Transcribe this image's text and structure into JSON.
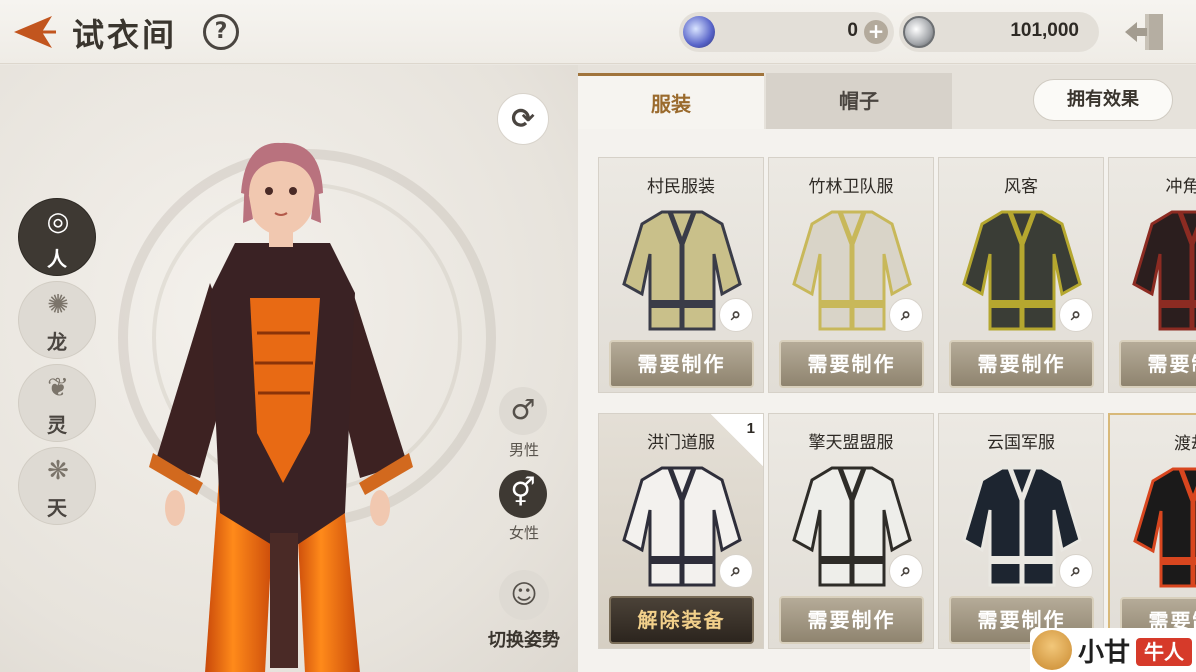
{
  "header": {
    "title": "试衣间",
    "help_symbol": "?",
    "gem_currency": {
      "value": "0",
      "add_symbol": "+"
    },
    "coin_currency": {
      "value": "101,000"
    }
  },
  "stage": {
    "races": [
      {
        "label": "人",
        "icon": "human-emblem-icon",
        "active": true
      },
      {
        "label": "龙",
        "icon": "dragon-emblem-icon",
        "active": false
      },
      {
        "label": "灵",
        "icon": "spirit-emblem-icon",
        "active": false
      },
      {
        "label": "天",
        "icon": "heaven-emblem-icon",
        "active": false
      }
    ],
    "rotate_symbol": "⟳",
    "gender_male": {
      "label": "男性",
      "symbol": "♂"
    },
    "gender_female": {
      "label": "女性",
      "symbol": "⚥"
    },
    "pose": {
      "label": "切换姿势",
      "symbol": "☺"
    }
  },
  "panel": {
    "tabs": [
      {
        "label": "服装",
        "active": true
      },
      {
        "label": "帽子",
        "active": false
      }
    ],
    "effects_label": "拥有效果",
    "items": [
      {
        "name": "村民服装",
        "action": "需要制作",
        "palette": [
          "#c9c08a",
          "#3a3c48"
        ]
      },
      {
        "name": "竹林卫队服",
        "action": "需要制作",
        "palette": [
          "#d9d4c8",
          "#c8b85a"
        ]
      },
      {
        "name": "风客",
        "action": "需要制作",
        "palette": [
          "#3a3d36",
          "#b5a72f"
        ]
      },
      {
        "name": "冲角团",
        "action": "需要制作",
        "palette": [
          "#2b1e1e",
          "#8c2b22"
        ]
      },
      {
        "name": "洪门道服",
        "action": "解除装备",
        "count": "1",
        "palette": [
          "#f3f1ee",
          "#2e2e3a"
        ]
      },
      {
        "name": "擎天盟盟服",
        "action": "需要制作",
        "palette": [
          "#eeeeea",
          "#2e2c28"
        ]
      },
      {
        "name": "云国军服",
        "action": "需要制作",
        "palette": [
          "#1d2530",
          "#e9e7e1"
        ]
      },
      {
        "name": "渡劫",
        "action": "需要制作",
        "palette": [
          "#1b1a1a",
          "#d8461f"
        ]
      }
    ],
    "zoom_symbol": "⌕"
  },
  "watermark": {
    "text": "小甘",
    "badge": "牛人"
  }
}
